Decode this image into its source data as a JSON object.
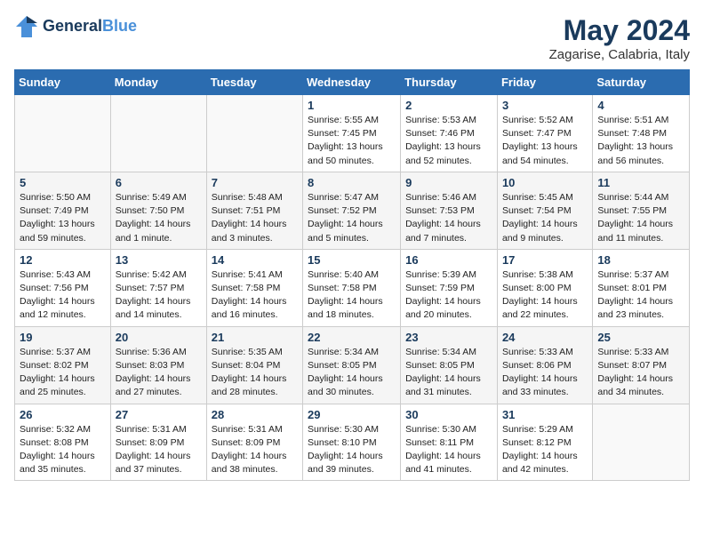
{
  "header": {
    "logo_line1": "General",
    "logo_line2": "Blue",
    "month": "May 2024",
    "location": "Zagarise, Calabria, Italy"
  },
  "days_of_week": [
    "Sunday",
    "Monday",
    "Tuesday",
    "Wednesday",
    "Thursday",
    "Friday",
    "Saturday"
  ],
  "weeks": [
    [
      {
        "day": "",
        "info": ""
      },
      {
        "day": "",
        "info": ""
      },
      {
        "day": "",
        "info": ""
      },
      {
        "day": "1",
        "info": "Sunrise: 5:55 AM\nSunset: 7:45 PM\nDaylight: 13 hours\nand 50 minutes."
      },
      {
        "day": "2",
        "info": "Sunrise: 5:53 AM\nSunset: 7:46 PM\nDaylight: 13 hours\nand 52 minutes."
      },
      {
        "day": "3",
        "info": "Sunrise: 5:52 AM\nSunset: 7:47 PM\nDaylight: 13 hours\nand 54 minutes."
      },
      {
        "day": "4",
        "info": "Sunrise: 5:51 AM\nSunset: 7:48 PM\nDaylight: 13 hours\nand 56 minutes."
      }
    ],
    [
      {
        "day": "5",
        "info": "Sunrise: 5:50 AM\nSunset: 7:49 PM\nDaylight: 13 hours\nand 59 minutes."
      },
      {
        "day": "6",
        "info": "Sunrise: 5:49 AM\nSunset: 7:50 PM\nDaylight: 14 hours\nand 1 minute."
      },
      {
        "day": "7",
        "info": "Sunrise: 5:48 AM\nSunset: 7:51 PM\nDaylight: 14 hours\nand 3 minutes."
      },
      {
        "day": "8",
        "info": "Sunrise: 5:47 AM\nSunset: 7:52 PM\nDaylight: 14 hours\nand 5 minutes."
      },
      {
        "day": "9",
        "info": "Sunrise: 5:46 AM\nSunset: 7:53 PM\nDaylight: 14 hours\nand 7 minutes."
      },
      {
        "day": "10",
        "info": "Sunrise: 5:45 AM\nSunset: 7:54 PM\nDaylight: 14 hours\nand 9 minutes."
      },
      {
        "day": "11",
        "info": "Sunrise: 5:44 AM\nSunset: 7:55 PM\nDaylight: 14 hours\nand 11 minutes."
      }
    ],
    [
      {
        "day": "12",
        "info": "Sunrise: 5:43 AM\nSunset: 7:56 PM\nDaylight: 14 hours\nand 12 minutes."
      },
      {
        "day": "13",
        "info": "Sunrise: 5:42 AM\nSunset: 7:57 PM\nDaylight: 14 hours\nand 14 minutes."
      },
      {
        "day": "14",
        "info": "Sunrise: 5:41 AM\nSunset: 7:58 PM\nDaylight: 14 hours\nand 16 minutes."
      },
      {
        "day": "15",
        "info": "Sunrise: 5:40 AM\nSunset: 7:58 PM\nDaylight: 14 hours\nand 18 minutes."
      },
      {
        "day": "16",
        "info": "Sunrise: 5:39 AM\nSunset: 7:59 PM\nDaylight: 14 hours\nand 20 minutes."
      },
      {
        "day": "17",
        "info": "Sunrise: 5:38 AM\nSunset: 8:00 PM\nDaylight: 14 hours\nand 22 minutes."
      },
      {
        "day": "18",
        "info": "Sunrise: 5:37 AM\nSunset: 8:01 PM\nDaylight: 14 hours\nand 23 minutes."
      }
    ],
    [
      {
        "day": "19",
        "info": "Sunrise: 5:37 AM\nSunset: 8:02 PM\nDaylight: 14 hours\nand 25 minutes."
      },
      {
        "day": "20",
        "info": "Sunrise: 5:36 AM\nSunset: 8:03 PM\nDaylight: 14 hours\nand 27 minutes."
      },
      {
        "day": "21",
        "info": "Sunrise: 5:35 AM\nSunset: 8:04 PM\nDaylight: 14 hours\nand 28 minutes."
      },
      {
        "day": "22",
        "info": "Sunrise: 5:34 AM\nSunset: 8:05 PM\nDaylight: 14 hours\nand 30 minutes."
      },
      {
        "day": "23",
        "info": "Sunrise: 5:34 AM\nSunset: 8:05 PM\nDaylight: 14 hours\nand 31 minutes."
      },
      {
        "day": "24",
        "info": "Sunrise: 5:33 AM\nSunset: 8:06 PM\nDaylight: 14 hours\nand 33 minutes."
      },
      {
        "day": "25",
        "info": "Sunrise: 5:33 AM\nSunset: 8:07 PM\nDaylight: 14 hours\nand 34 minutes."
      }
    ],
    [
      {
        "day": "26",
        "info": "Sunrise: 5:32 AM\nSunset: 8:08 PM\nDaylight: 14 hours\nand 35 minutes."
      },
      {
        "day": "27",
        "info": "Sunrise: 5:31 AM\nSunset: 8:09 PM\nDaylight: 14 hours\nand 37 minutes."
      },
      {
        "day": "28",
        "info": "Sunrise: 5:31 AM\nSunset: 8:09 PM\nDaylight: 14 hours\nand 38 minutes."
      },
      {
        "day": "29",
        "info": "Sunrise: 5:30 AM\nSunset: 8:10 PM\nDaylight: 14 hours\nand 39 minutes."
      },
      {
        "day": "30",
        "info": "Sunrise: 5:30 AM\nSunset: 8:11 PM\nDaylight: 14 hours\nand 41 minutes."
      },
      {
        "day": "31",
        "info": "Sunrise: 5:29 AM\nSunset: 8:12 PM\nDaylight: 14 hours\nand 42 minutes."
      },
      {
        "day": "",
        "info": ""
      }
    ]
  ]
}
